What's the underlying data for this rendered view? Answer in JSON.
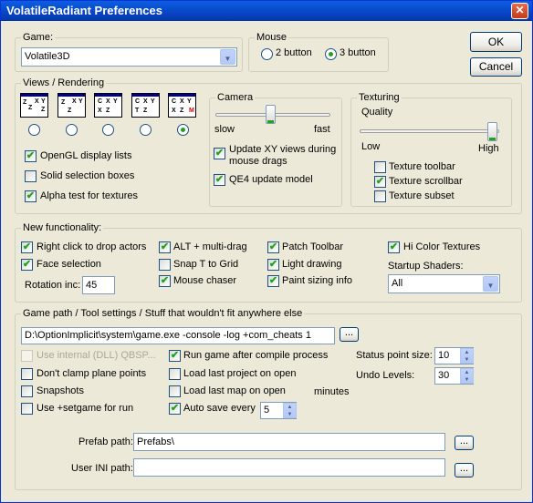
{
  "window": {
    "title": "VolatileRadiant Preferences",
    "close_glyph": "✕"
  },
  "buttons": {
    "ok": "OK",
    "cancel": "Cancel",
    "browse": "..."
  },
  "game": {
    "label": "Game:",
    "value": "Volatile3D"
  },
  "mouse": {
    "label": "Mouse",
    "two_button": "2 button",
    "three_button": "3 button",
    "selected": "3 button"
  },
  "views": {
    "label": "Views / Rendering",
    "selected_index": 4,
    "opengl_display_lists": {
      "label": "OpenGL display lists",
      "checked": true
    },
    "solid_selection_boxes": {
      "label": "Solid selection boxes",
      "checked": false
    },
    "alpha_test": {
      "label": "Alpha test for textures",
      "checked": true
    }
  },
  "camera": {
    "label": "Camera",
    "slow": "slow",
    "fast": "fast",
    "speed_fraction": 0.55,
    "update_xy": {
      "label_line1": "Update XY views during",
      "label_line2": "mouse drags",
      "checked": true
    },
    "qe4_update": {
      "label": "QE4 update model",
      "checked": true
    }
  },
  "texturing": {
    "label": "Texturing",
    "quality": "Quality",
    "low": "Low",
    "high": "High",
    "quality_fraction": 1.0,
    "toolbar": {
      "label": "Texture toolbar",
      "checked": false
    },
    "scrollbar": {
      "label": "Texture scrollbar",
      "checked": true
    },
    "subset": {
      "label": "Texture subset",
      "checked": false
    }
  },
  "new_functionality": {
    "label": "New functionality:",
    "right_click": {
      "label": "Right click to drop actors",
      "checked": true
    },
    "alt_multidrag": {
      "label": "ALT + multi-drag",
      "checked": true
    },
    "patch_toolbar": {
      "label": "Patch Toolbar",
      "checked": true
    },
    "hi_color": {
      "label": "Hi Color Textures",
      "checked": true
    },
    "face_selection": {
      "label": "Face selection",
      "checked": true
    },
    "snap_t": {
      "label": "Snap T to Grid",
      "checked": false
    },
    "light_drawing": {
      "label": "Light drawing",
      "checked": true
    },
    "mouse_chaser": {
      "label": "Mouse chaser",
      "checked": true
    },
    "paint_sizing": {
      "label": "Paint sizing info",
      "checked": true
    },
    "rotation_label": "Rotation inc:",
    "rotation_value": "45",
    "startup_shaders_label": "Startup Shaders:",
    "startup_shaders_value": "All"
  },
  "game_path": {
    "label": "Game path / Tool settings / Stuff that wouldn't fit anywhere else",
    "path_value": "D:\\OptionImplicit\\system\\game.exe -console -log +com_cheats 1",
    "use_internal": {
      "label": "Use internal (DLL) QBSP...",
      "checked": false
    },
    "dont_clamp": {
      "label": "Don't clamp plane points",
      "checked": false
    },
    "snapshots": {
      "label": "Snapshots",
      "checked": false
    },
    "use_setgame": {
      "label": "Use +setgame for run",
      "checked": false
    },
    "run_after_compile": {
      "label": "Run game after compile process",
      "checked": true
    },
    "load_last_project": {
      "label": "Load last project on open",
      "checked": false
    },
    "load_last_map": {
      "label": "Load last map on open",
      "checked": false
    },
    "auto_save": {
      "label": "Auto save every",
      "checked": true
    },
    "auto_save_value": "5",
    "minutes": "minutes",
    "status_point_label": "Status point size:",
    "status_point_value": "10",
    "undo_levels_label": "Undo Levels:",
    "undo_levels_value": "30",
    "prefab_label": "Prefab path:",
    "prefab_value": "Prefabs\\",
    "user_ini_label": "User INI path:",
    "user_ini_value": ""
  },
  "glyphs": {
    "check": "✔",
    "down": "▼",
    "up": "▲"
  }
}
